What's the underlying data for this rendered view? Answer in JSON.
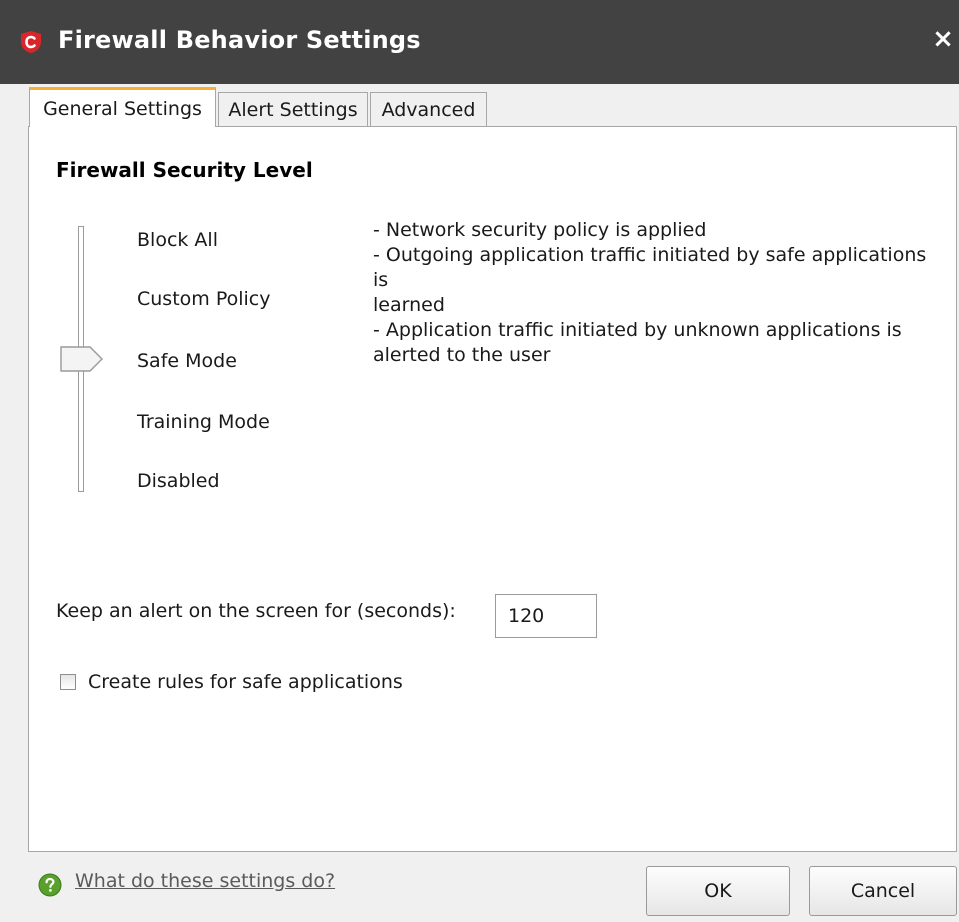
{
  "window": {
    "title": "Firewall Behavior Settings",
    "close_glyph": "×",
    "colors": {
      "titlebar": "#424242",
      "active_tab_accent": "#f6b132",
      "logo_red": "#d8262a"
    }
  },
  "tabs": [
    {
      "label": "General Settings",
      "active": true
    },
    {
      "label": "Alert Settings",
      "active": false
    },
    {
      "label": "Advanced",
      "active": false
    }
  ],
  "security": {
    "title": "Firewall Security Level",
    "levels": [
      "Block All",
      "Custom Policy",
      "Safe Mode",
      "Training Mode",
      "Disabled"
    ],
    "selected_level": "Safe Mode",
    "description": "- Network security policy is applied\n- Outgoing application traffic initiated by safe applications is\n  learned\n- Application traffic initiated by unknown applications is alerted to the user"
  },
  "alert": {
    "label": "Keep an alert on the screen for (seconds):",
    "value": "120"
  },
  "create_rules": {
    "label": "Create rules for safe applications",
    "checked": false
  },
  "footer": {
    "help_link": "What do these settings do?",
    "ok_label": "OK",
    "cancel_label": "Cancel",
    "help_icon": "question-circle-icon"
  }
}
